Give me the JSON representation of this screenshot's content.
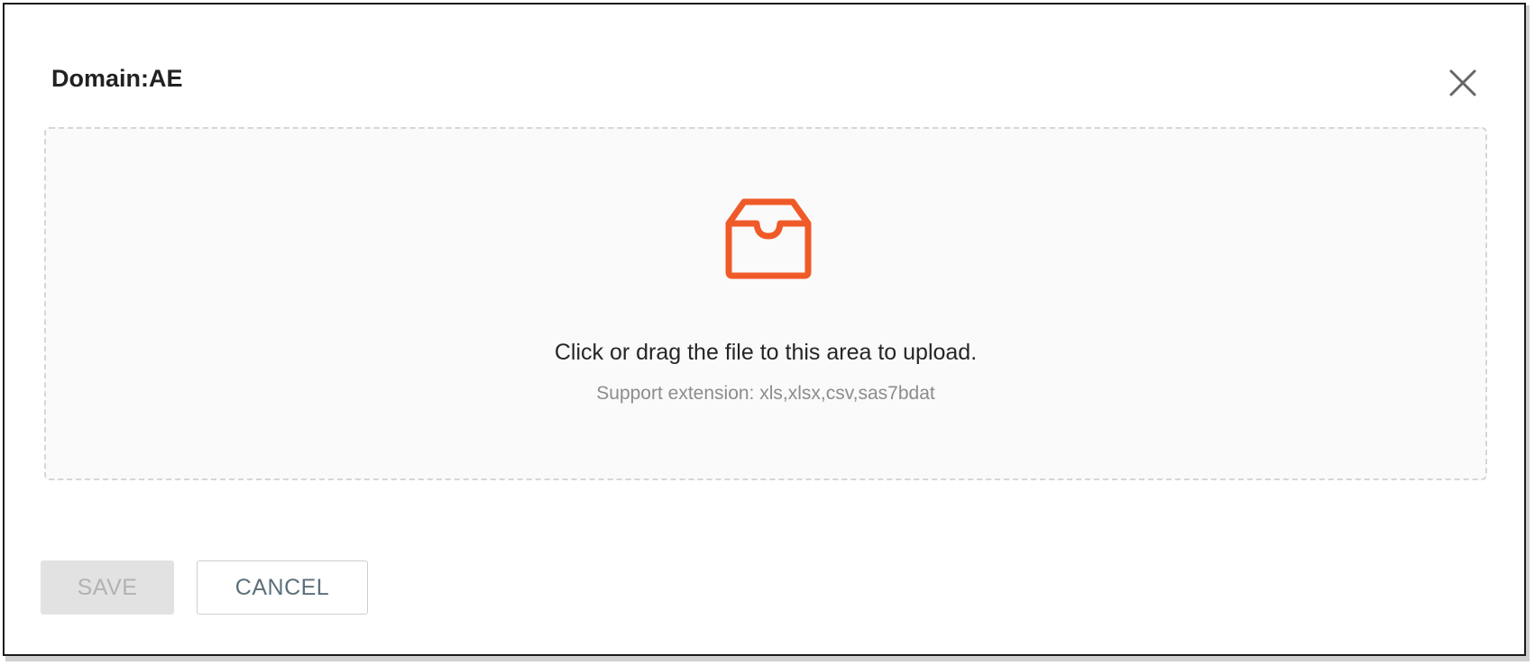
{
  "dialog": {
    "title": "Domain:AE",
    "close_icon": "close-icon"
  },
  "upload": {
    "icon": "inbox-icon",
    "icon_color": "#f05a28",
    "text": "Click or drag the file to this area to upload.",
    "hint": "Support extension: xls,xlsx,csv,sas7bdat"
  },
  "buttons": {
    "save_label": "SAVE",
    "save_disabled": true,
    "cancel_label": "CANCEL"
  }
}
